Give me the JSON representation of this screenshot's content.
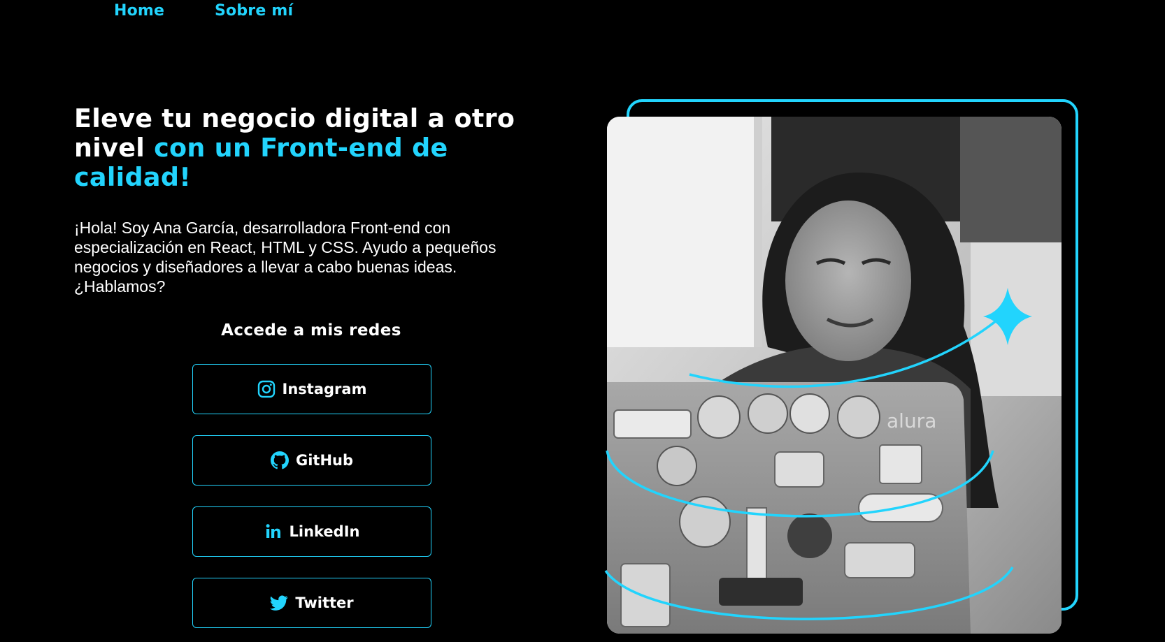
{
  "nav": {
    "home": "Home",
    "about": "Sobre mí"
  },
  "hero": {
    "title_main": "Eleve tu negocio digital a otro nivel",
    "title_accent": "con un Front-end de calidad!",
    "intro": "¡Hola! Soy Ana García, desarrolladora Front-end con especialización en React, HTML y CSS. Ayudo a pequeños negocios y diseñadores a llevar a cabo buenas ideas. ¿Hablamos?"
  },
  "social": {
    "title": "Accede a mis redes",
    "buttons": [
      {
        "label": "Instagram",
        "icon": "instagram-icon"
      },
      {
        "label": "GitHub",
        "icon": "github-icon"
      },
      {
        "label": "LinkedIn",
        "icon": "linkedin-icon"
      },
      {
        "label": "Twitter",
        "icon": "twitter-icon"
      }
    ]
  },
  "photo": {
    "alt": "photo",
    "sticker_text": "alura"
  },
  "colors": {
    "accent": "#22d4fd",
    "background": "#000000",
    "text": "#ffffff"
  }
}
